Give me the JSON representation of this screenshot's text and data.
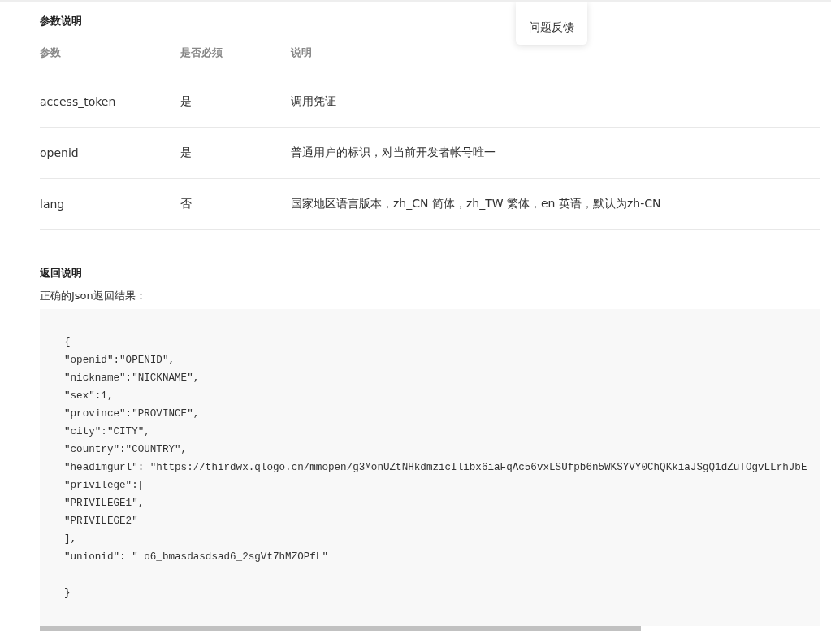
{
  "params_section": {
    "title": "参数说明",
    "table": {
      "columns": [
        "参数",
        "是否必须",
        "说明"
      ],
      "rows": [
        [
          "access_token",
          "是",
          "调用凭证"
        ],
        [
          "openid",
          "是",
          "普通用户的标识，对当前开发者帐号唯一"
        ],
        [
          "lang",
          "否",
          "国家地区语言版本，zh_CN 简体，zh_TW 繁体，en 英语，默认为zh-CN"
        ]
      ]
    }
  },
  "return_section": {
    "title": "返回说明",
    "intro": "正确的Json返回结果：",
    "code": {
      "opening": "{",
      "lines": [
        "\"openid\":\"OPENID\",",
        "\"nickname\":\"NICKNAME\",",
        "\"sex\":1,",
        "\"province\":\"PROVINCE\",",
        "\"city\":\"CITY\",",
        "\"country\":\"COUNTRY\",",
        "\"headimgurl\": \"https://thirdwx.qlogo.cn/mmopen/g3MonUZtNHkdmzicIlibx6iaFqAc56vxLSUfpb6n5WKSYVY0ChQKkiaJSgQ1dZuTOgvLLrhJbE",
        "\"privilege\":[",
        "\"PRIVILEGE1\",",
        "\"PRIVILEGE2\"",
        "],",
        "\"unionid\": \" o6_bmasdasdsad6_2sgVt7hMZOPfL\""
      ],
      "closing": "}"
    }
  },
  "popup_menu": {
    "items": [
      "问题反馈"
    ]
  }
}
